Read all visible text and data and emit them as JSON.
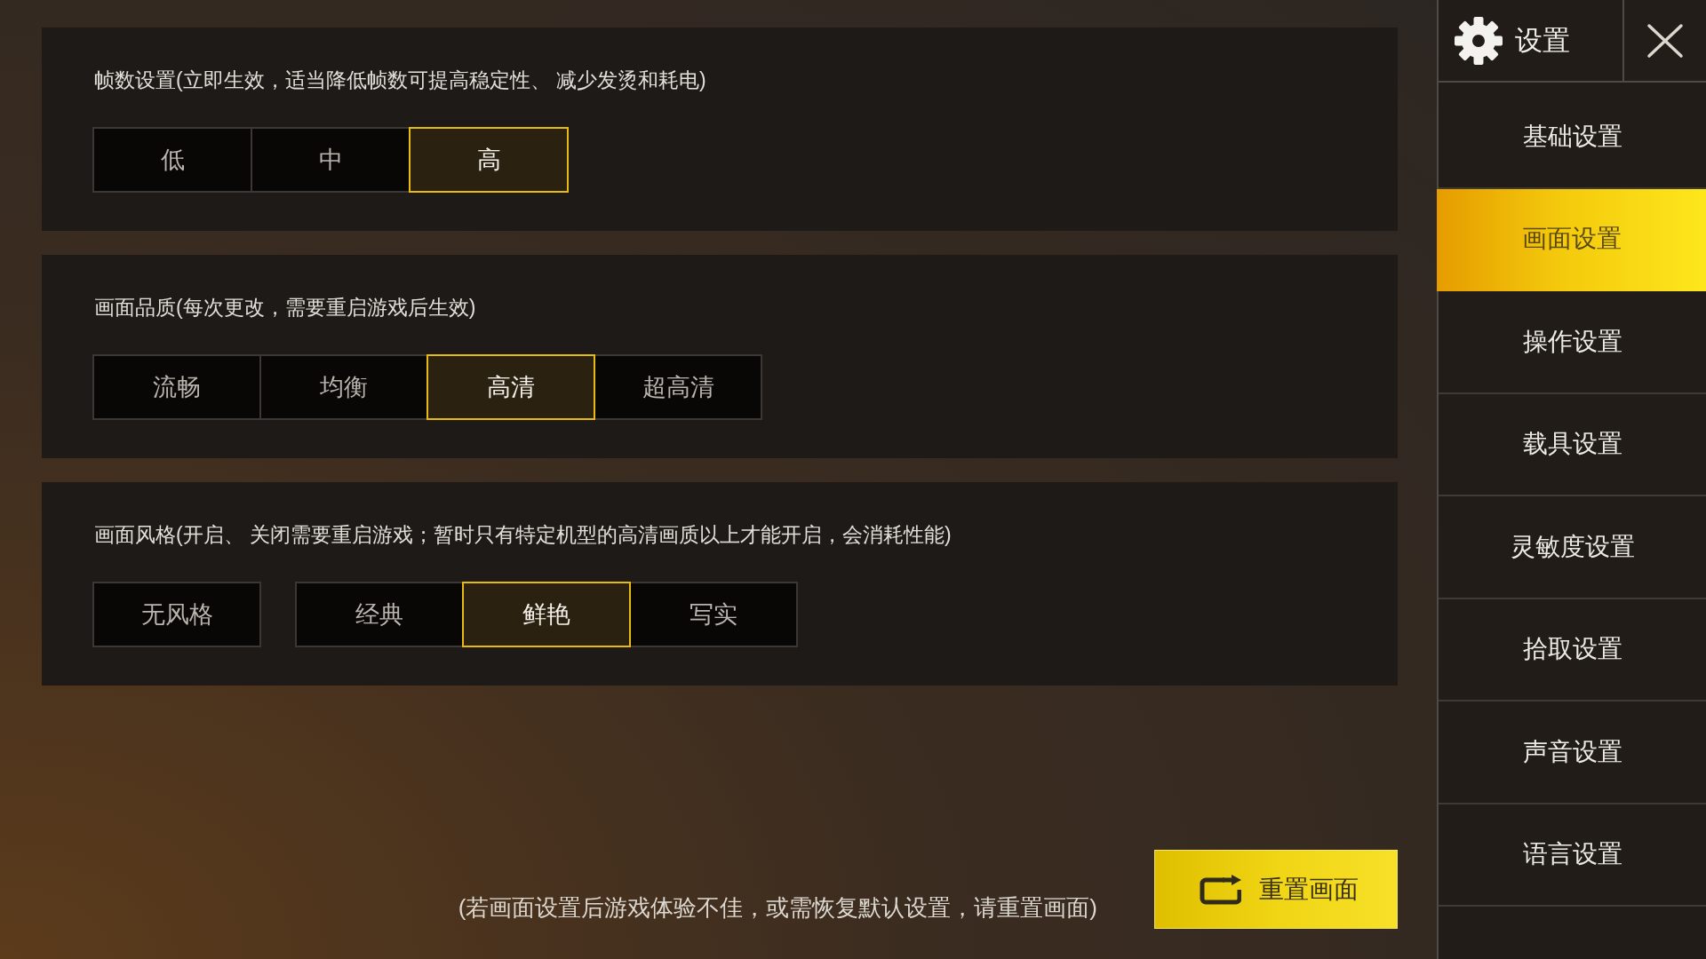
{
  "sections": [
    {
      "title": "帧数设置(立即生效，适当降低帧数可提高稳定性、 减少发烫和耗电)",
      "option_groups": [
        [
          {
            "label": "低",
            "selected": false
          },
          {
            "label": "中",
            "selected": false
          },
          {
            "label": "高",
            "selected": true
          }
        ]
      ]
    },
    {
      "title": "画面品质(每次更改，需要重启游戏后生效)",
      "option_groups": [
        [
          {
            "label": "流畅",
            "selected": false
          },
          {
            "label": "均衡",
            "selected": false
          },
          {
            "label": "高清",
            "selected": true
          },
          {
            "label": "超高清",
            "selected": false
          }
        ]
      ]
    },
    {
      "title": "画面风格(开启、 关闭需要重启游戏；暂时只有特定机型的高清画质以上才能开启，会消耗性能)",
      "option_groups": [
        [
          {
            "label": "无风格",
            "selected": false
          }
        ],
        [
          {
            "label": "经典",
            "selected": false
          },
          {
            "label": "鲜艳",
            "selected": true
          },
          {
            "label": "写实",
            "selected": false
          }
        ]
      ]
    }
  ],
  "footer": {
    "note": "(若画面设置后游戏体验不佳，或需恢复默认设置，请重置画面)",
    "reset_button": "重置画面"
  },
  "sidebar": {
    "title": "设置",
    "items": [
      {
        "label": "基础设置",
        "selected": false
      },
      {
        "label": "画面设置",
        "selected": true
      },
      {
        "label": "操作设置",
        "selected": false
      },
      {
        "label": "载具设置",
        "selected": false
      },
      {
        "label": "灵敏度设置",
        "selected": false
      },
      {
        "label": "拾取设置",
        "selected": false
      },
      {
        "label": "声音设置",
        "selected": false
      },
      {
        "label": "语言设置",
        "selected": false
      }
    ]
  }
}
